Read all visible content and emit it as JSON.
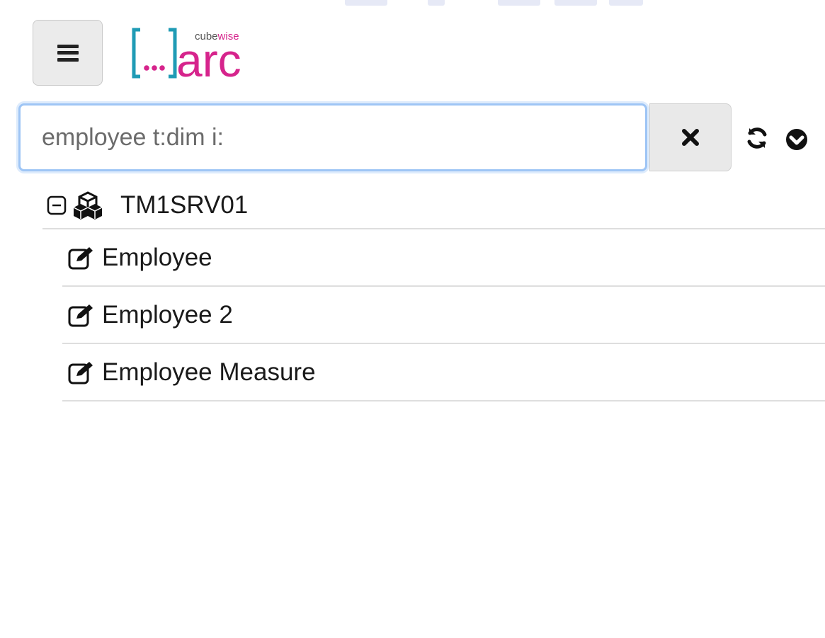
{
  "app": {
    "logo": {
      "text": "arc",
      "brand": "cubewise",
      "bracket": "[…]"
    }
  },
  "toolbar": {
    "menu_icon": "hamburger-icon"
  },
  "search": {
    "value": "employee t:dim i:",
    "clear_icon": "close-icon",
    "refresh_icon": "refresh-icon",
    "options_icon": "chevron-circle-down-icon"
  },
  "tree": {
    "server": {
      "label": "TM1SRV01",
      "expanded": true,
      "icon": "cubes-icon"
    },
    "items": [
      {
        "label": "Employee",
        "icon": "edit-icon"
      },
      {
        "label": "Employee 2",
        "icon": "edit-icon"
      },
      {
        "label": "Employee Measure",
        "icon": "edit-icon"
      }
    ]
  },
  "colors": {
    "brand_teal": "#1f9bb5",
    "brand_magenta": "#d6248c",
    "focus_blue": "#9ec5f5"
  }
}
